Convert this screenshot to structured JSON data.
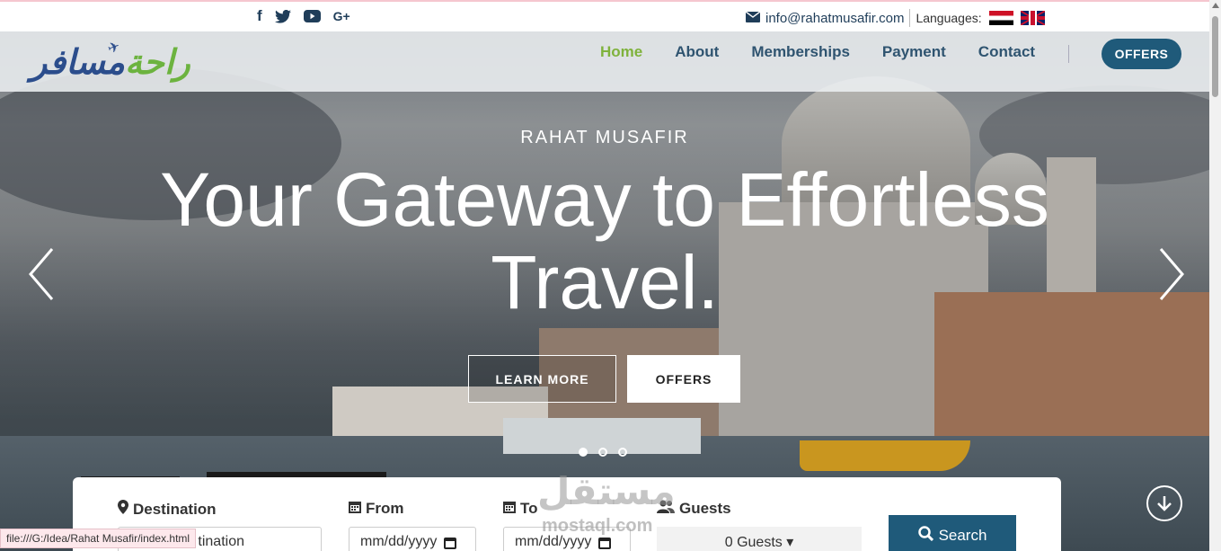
{
  "topbar": {
    "social": [
      {
        "icon": "facebook-icon",
        "glyph": "f"
      },
      {
        "icon": "twitter-icon",
        "glyph": "🐦"
      },
      {
        "icon": "youtube-icon",
        "glyph": "▶"
      },
      {
        "icon": "google-plus-icon",
        "glyph": "G+"
      }
    ],
    "email": "info@rahatmusafir.com",
    "languages_label": "Languages:"
  },
  "navbar": {
    "logo_text_green": "راحة",
    "logo_text_blue": "مسافر",
    "links": [
      "Home",
      "About",
      "Memberships",
      "Payment",
      "Contact"
    ],
    "active": "Home",
    "offers_button": "OFFERS"
  },
  "hero": {
    "kicker": "RAHAT MUSAFIR",
    "headline": "Your Gateway to Effortless Travel.",
    "learn_more": "LEARN MORE",
    "offers": "OFFERS",
    "slides": 3,
    "active_slide": 1
  },
  "search": {
    "destination_label": "Destination",
    "destination_value": "tination",
    "from_label": "From",
    "from_placeholder": "mm/dd/yyyy",
    "to_label": "To",
    "to_placeholder": "mm/dd/yyyy",
    "guests_label": "Guests",
    "guests_value": "0 Guests ▾",
    "search_button": "Search"
  },
  "watermark": {
    "main": "مستقل",
    "sub": "mostaql.com"
  },
  "status_bar": "file:///G:/Idea/Rahat Musafir/index.html",
  "colors": {
    "brand_blue": "#1f5a7a",
    "nav_text": "#2f5470",
    "active_green": "#7fb23c"
  }
}
